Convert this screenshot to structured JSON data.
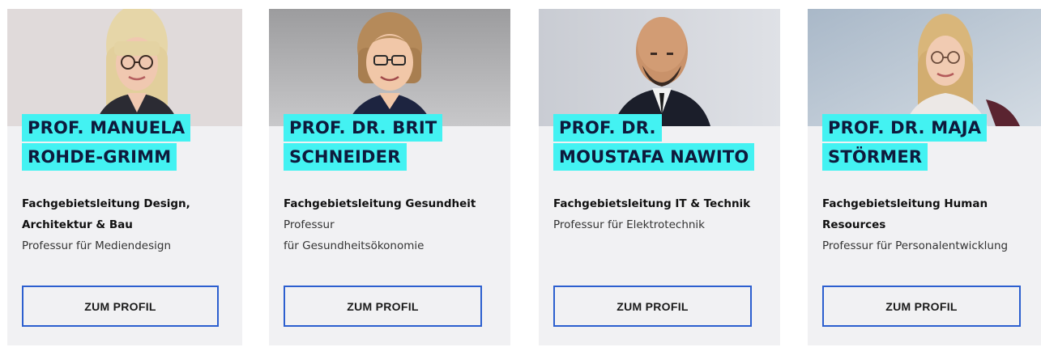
{
  "cards": [
    {
      "name_lines": [
        "PROF. MANUELA",
        "ROHDE-GRIMM"
      ],
      "role_lines": [
        "Fachgebietsleitung Design,",
        "Architektur & Bau"
      ],
      "prof_lines": [
        "Professur für Mediendesign"
      ],
      "button_label": "ZUM PROFIL"
    },
    {
      "name_lines": [
        "PROF. DR. BRIT",
        "SCHNEIDER"
      ],
      "role_lines": [
        "Fachgebietsleitung Gesundheit"
      ],
      "prof_lines": [
        "Professur",
        "für Gesundheitsökonomie"
      ],
      "button_label": "ZUM PROFIL"
    },
    {
      "name_lines": [
        "PROF. DR.",
        "MOUSTAFA NAWITO"
      ],
      "role_lines": [
        "Fachgebietsleitung IT & Technik"
      ],
      "prof_lines": [
        "Professur für Elektrotechnik"
      ],
      "button_label": "ZUM PROFIL"
    },
    {
      "name_lines": [
        "PROF. DR. MAJA",
        "STÖRMER"
      ],
      "role_lines": [
        "Fachgebietsleitung Human",
        "Resources"
      ],
      "prof_lines": [
        "Professur für Personalentwicklung"
      ],
      "button_label": "ZUM PROFIL"
    }
  ],
  "colors": {
    "name_highlight": "#43f2f2",
    "name_text": "#0e1a3c",
    "card_bg": "#f1f1f3",
    "button_border": "#2c5fcf"
  }
}
